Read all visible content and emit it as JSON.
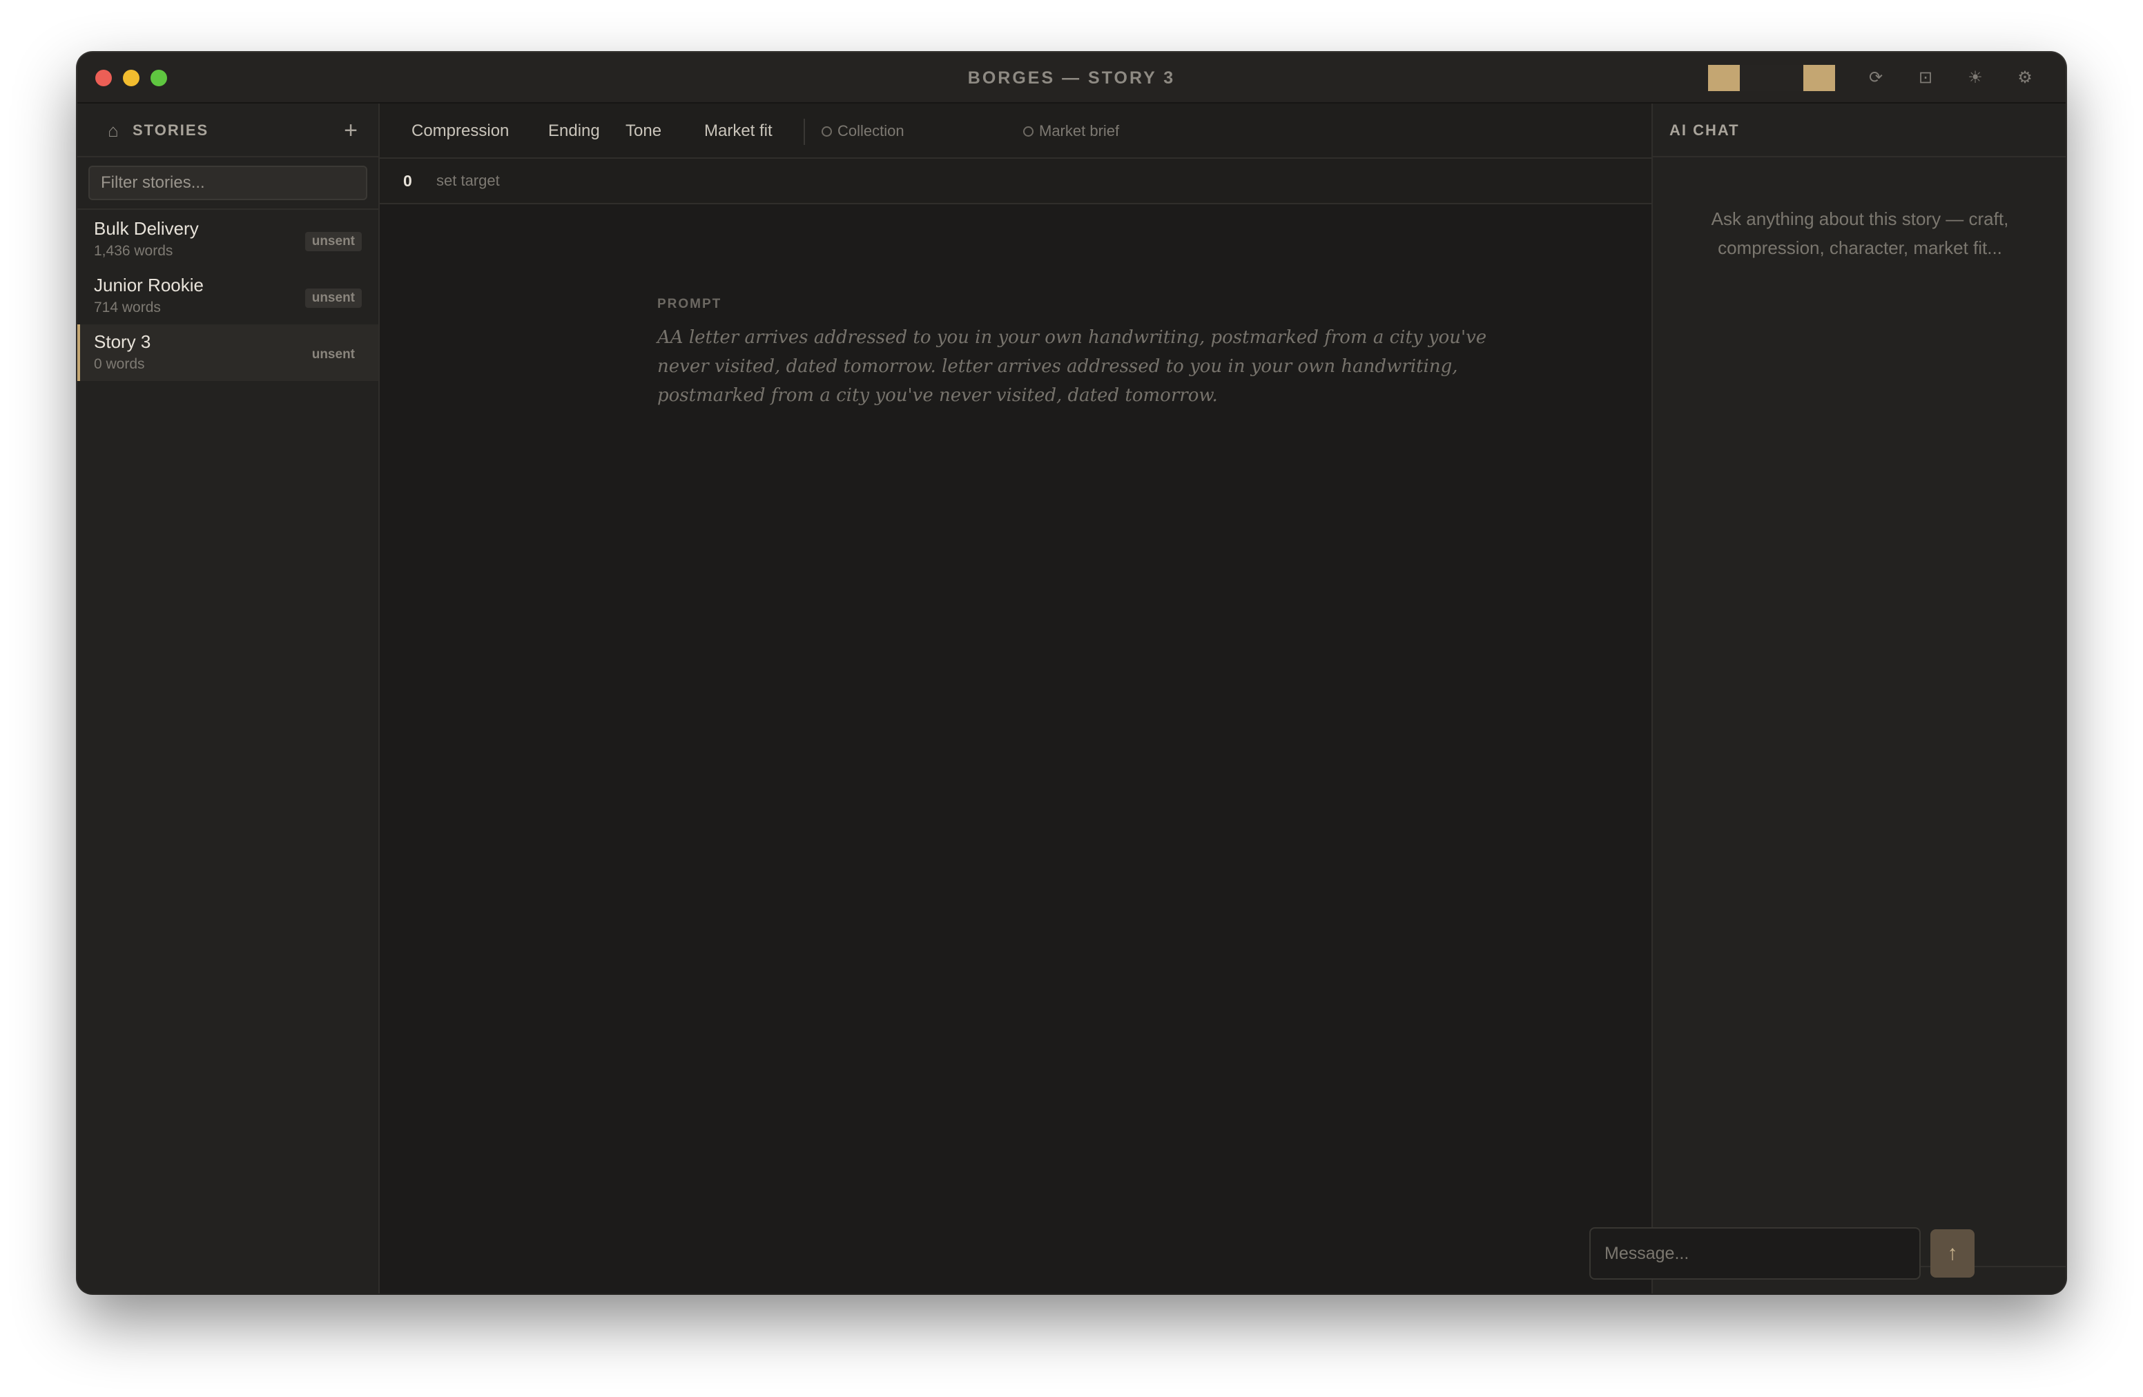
{
  "window": {
    "title": "BORGES — STORY 3"
  },
  "toolbar": {
    "swatches": [
      "#c4a672",
      "#262422",
      "#262422",
      "#c4a672"
    ],
    "icons": [
      "refresh-icon",
      "layout-icon",
      "sun-icon",
      "gear-icon"
    ],
    "icon_glyphs": {
      "refresh": "⟳",
      "layout": "⊡",
      "sun": "☀",
      "settings": "⚙"
    }
  },
  "sidebar": {
    "title": "STORIES",
    "home_glyph": "⌂",
    "add_glyph": "+",
    "filter_placeholder": "Filter stories...",
    "stories": [
      {
        "title": "Bulk Delivery",
        "words": "1,436 words",
        "status": "unsent",
        "active": false
      },
      {
        "title": "Junior Rookie",
        "words": "714 words",
        "status": "unsent",
        "active": false
      },
      {
        "title": "Story 3",
        "words": "0 words",
        "status": "unsent",
        "active": true
      }
    ]
  },
  "main": {
    "tabs": [
      "Compression",
      "Ending",
      "Tone",
      "Market fit"
    ],
    "secondary_tabs": [
      "Collection",
      "Market brief"
    ],
    "word_count": "0",
    "set_target_label": "set target",
    "prompt_label": "PROMPT",
    "prompt_text": "AA letter arrives addressed to you in your own handwriting, postmarked from a city you've never visited, dated tomorrow. letter arrives addressed to you in your own handwriting, postmarked from a city you've never visited, dated tomorrow."
  },
  "chat": {
    "title": "AI CHAT",
    "empty_text": "Ask anything about this story — craft, compression, character, market fit...",
    "message_placeholder": "Message...",
    "send_glyph": "↑"
  },
  "colors": {
    "accent": "#c4a672",
    "background": "#1c1b1a",
    "panel": "#232220"
  }
}
